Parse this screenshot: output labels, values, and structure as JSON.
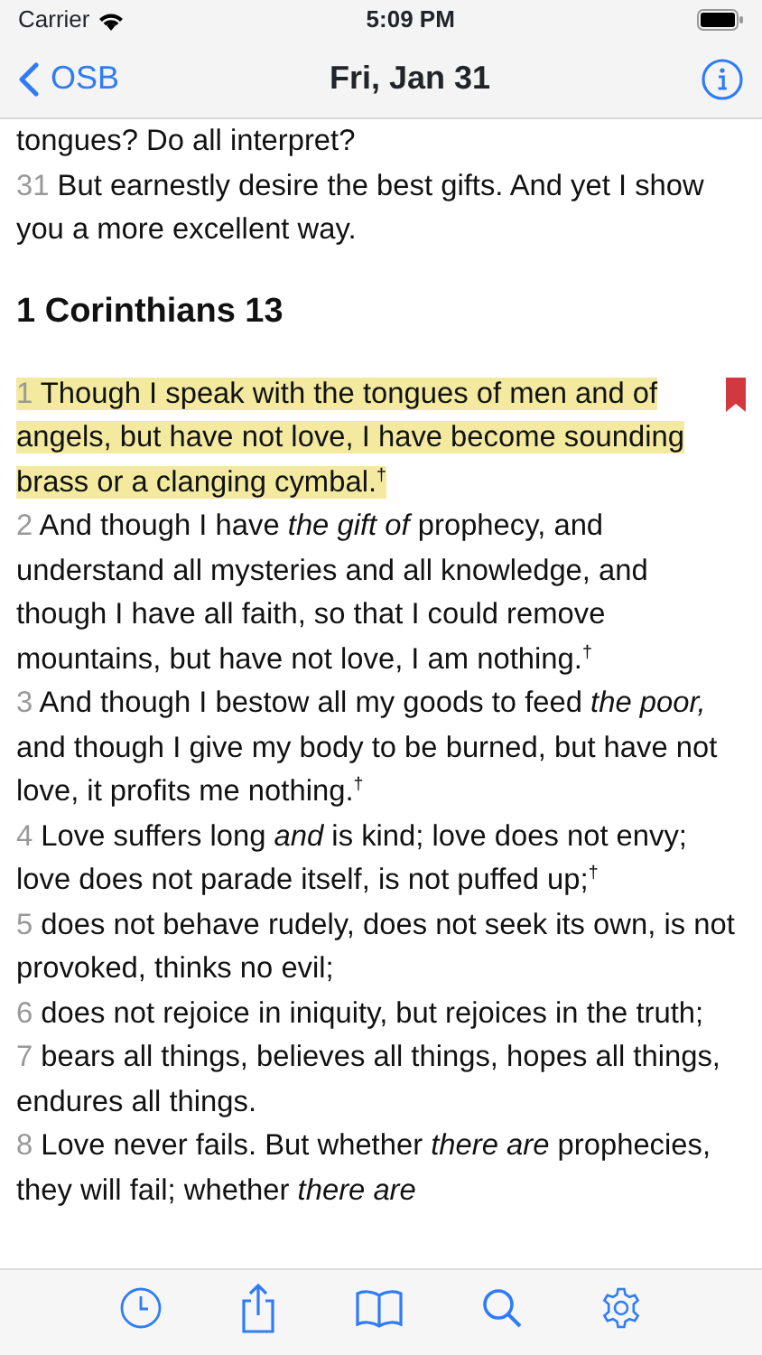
{
  "status_bar": {
    "carrier": "Carrier",
    "time": "5:09 PM"
  },
  "nav": {
    "back_label": "OSB",
    "title": "Fri, Jan 31"
  },
  "blocks": [
    {
      "kind": "verse",
      "text": "tongues? Do all interpret?",
      "highlighted": false,
      "bookmarked": false
    },
    {
      "kind": "verse",
      "number": "31",
      "text": "But earnestly desire the best gifts. And yet I show you a more excellent way.",
      "highlighted": false,
      "bookmarked": false
    },
    {
      "kind": "heading",
      "text": "1 Corinthians 13"
    },
    {
      "kind": "verse",
      "number": "1",
      "text": "Though I speak with the tongues of men and of angels, but have not love, I have become sounding brass or a clanging cymbal.$^{†}$",
      "highlighted": true,
      "bookmarked": true
    },
    {
      "kind": "verse",
      "number": "2",
      "text": "And though I have *the gift of* prophecy, and understand all mysteries and all knowledge, and though I have all faith, so that I could remove mountains, but have not love, I am nothing.$^{†}$",
      "highlighted": false,
      "bookmarked": false
    },
    {
      "kind": "verse",
      "number": "3",
      "text": "And though I bestow all my goods to feed *the poor,* and though I give my body to be burned, but have not love, it profits me nothing.$^{†}$",
      "highlighted": false,
      "bookmarked": false
    },
    {
      "kind": "verse",
      "number": "4",
      "text": "Love suffers long *and* is kind; love does not envy; love does not parade itself, is not puffed up;$^{†}$",
      "highlighted": false,
      "bookmarked": false
    },
    {
      "kind": "verse",
      "number": "5",
      "text": "does not behave rudely, does not seek its own, is not provoked, thinks no evil;",
      "highlighted": false,
      "bookmarked": false
    },
    {
      "kind": "verse",
      "number": "6",
      "text": "does not rejoice in iniquity, but rejoices in the truth;",
      "highlighted": false,
      "bookmarked": false
    },
    {
      "kind": "verse",
      "number": "7",
      "text": "bears all things, believes all things, hopes all things, endures all things.",
      "highlighted": false,
      "bookmarked": false
    },
    {
      "kind": "verse",
      "number": "8",
      "text": "Love never fails. But whether *there are* prophecies, they will fail; whether *there are*",
      "highlighted": false,
      "bookmarked": false
    }
  ]
}
